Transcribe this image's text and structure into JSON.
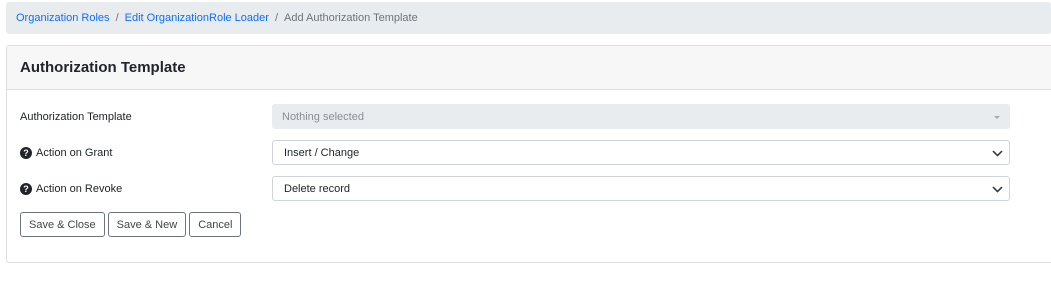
{
  "breadcrumb": {
    "items": [
      "Organization Roles",
      "Edit OrganizationRole Loader"
    ],
    "current": "Add Authorization Template",
    "separator": "/"
  },
  "card": {
    "title": "Authorization Template"
  },
  "form": {
    "template": {
      "label": "Authorization Template",
      "placeholder": "Nothing selected"
    },
    "grant": {
      "label": "Action on Grant",
      "value": "Insert / Change"
    },
    "revoke": {
      "label": "Action on Revoke",
      "value": "Delete record"
    }
  },
  "buttons": {
    "save_close": "Save & Close",
    "save_new": "Save & New",
    "cancel": "Cancel"
  },
  "icons": {
    "help": "question-circle-icon",
    "dropdown": "chevron-down-icon"
  },
  "colors": {
    "link": "#0d6efd",
    "breadcrumb_bg": "#e9ecef",
    "header_bg": "#f7f7f7"
  }
}
